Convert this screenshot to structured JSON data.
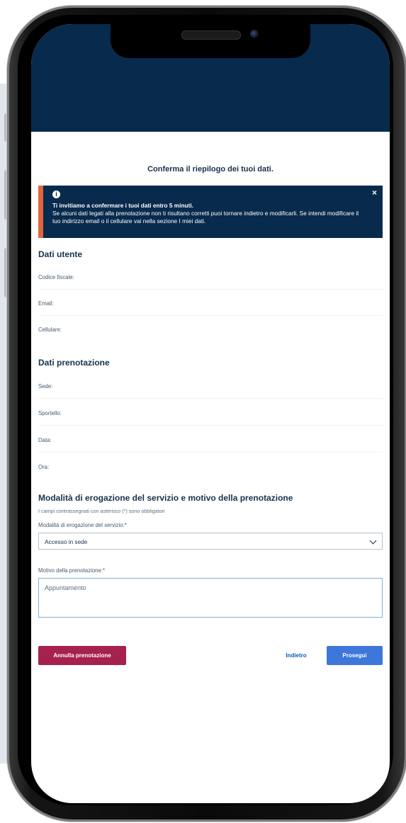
{
  "page": {
    "title": "Conferma il riepilogo dei tuoi dati."
  },
  "alert": {
    "icon": "info-icon",
    "title": "Ti invitiamo a confermare i tuoi dati entro 5 minuti.",
    "body": "Se alcuni dati legati alla prenotazione non ti risultano corretti puoi tornare indietro e modificarli. Se intendi modificare il tuo indirizzo email o il cellulare vai nella sezione I miei dati.",
    "close_label": "×",
    "accent_color": "#e0663c"
  },
  "user_section": {
    "title": "Dati utente",
    "fields": [
      "Codice fiscale:",
      "Email:",
      "Cellulare:"
    ]
  },
  "booking_section": {
    "title": "Dati prenotazione",
    "fields": [
      "Sede:",
      "Sportello:",
      "Data:",
      "Ora:"
    ]
  },
  "service_section": {
    "title": "Modalità di erogazione del servizio e motivo della prenotazione",
    "required_note": "I campi contrassegnati con asterisco (*) sono obbligatori",
    "mode_label": "Modalità di erogazione del servizio:*",
    "mode_value": "Accesso in sede",
    "reason_label": "Motivo della prenotazione:*",
    "reason_value": "Appuntamento"
  },
  "actions": {
    "cancel": "Annulla prenotazione",
    "back": "Indietro",
    "next": "Prosegui"
  },
  "colors": {
    "header": "#082a4d",
    "cancel": "#a6214e",
    "primary": "#3c77d9"
  }
}
